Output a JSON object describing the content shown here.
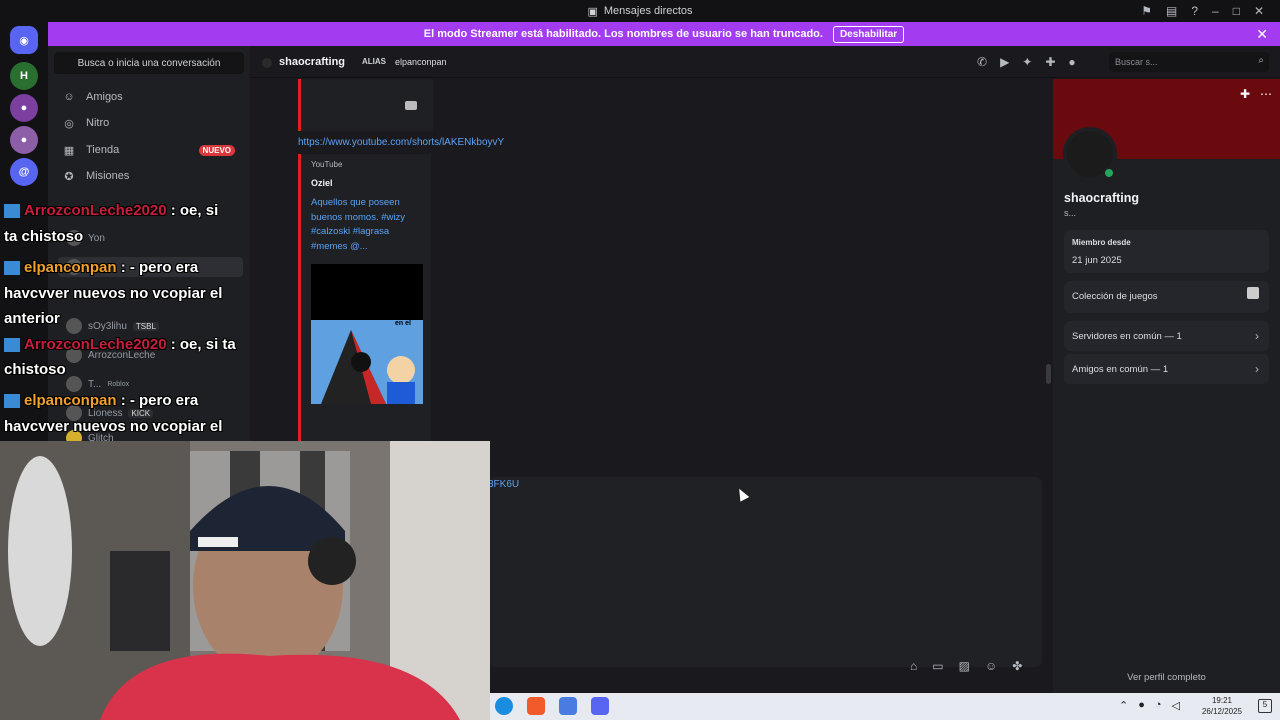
{
  "window": {
    "title": "Mensajes directos"
  },
  "banner": {
    "text": "El modo Streamer está habilitado. Los nombres de usuario se han truncado.",
    "button": "Deshabilitar"
  },
  "sidebar": {
    "search_placeholder": "Busca o inicia una conversación",
    "nav": [
      {
        "label": "Amigos",
        "icon": "friends-icon"
      },
      {
        "label": "Nitro",
        "icon": "nitro-icon"
      },
      {
        "label": "Tienda",
        "icon": "shop-icon",
        "badge": "NUEVO"
      },
      {
        "label": "Misiones",
        "icon": "quests-icon"
      }
    ],
    "dms": [
      {
        "name": "Yon"
      },
      {
        "name": "sOy3lihu",
        "tag": "TSBL"
      },
      {
        "name": "ArrozconLeche"
      },
      {
        "name": "T...",
        "sub": "Roblox"
      },
      {
        "name": "Lioness",
        "tag": "KICK"
      },
      {
        "name": "Glitch"
      }
    ]
  },
  "topbar": {
    "username": "shaocrafting",
    "alias_label": "ALIAS",
    "alias_value": "elpanconpan",
    "search_placeholder": "Buscar s..."
  },
  "chat": {
    "link1": "https://www.youtube.com/shorts/lAKENkboyvY",
    "embed": {
      "provider": "YouTube",
      "author": "Oziel",
      "description": "Aquellos que poseen buenos momos. #wizy #calzoski #lagrasa #memes @...",
      "thumb_text": "en el"
    },
    "link2": "3FK6U"
  },
  "profile": {
    "name": "shaocrafting",
    "sub": "s...",
    "member_since_label": "Miembro desde",
    "member_since": "21 jun 2025",
    "games": "Colección de juegos",
    "servers": "Servidores en común — 1",
    "friends": "Amigos en común — 1",
    "full_profile": "Ver perfil completo"
  },
  "overlay_chat": [
    {
      "nick": "ArrozconLeche2020",
      "color": "#c81e3c",
      "msg": ": oe, si",
      "cont": "ta chistoso"
    },
    {
      "nick": "elpanconpan",
      "color": "#f2a12a",
      "msg": ": - pero era",
      "cont": "havcvver nuevos no vcopiar el",
      "cont2": "anterior"
    },
    {
      "nick": "ArrozconLeche2020",
      "color": "#c81e3c",
      "msg": ": oe, si ta",
      "cont": "chistoso"
    },
    {
      "nick": "elpanconpan",
      "color": "#f2a12a",
      "msg": ": - pero era",
      "cont": "havcvver nuevos no vcopiar el"
    }
  ],
  "taskbar": {
    "time": "19:21",
    "date": "26/12/2025",
    "notifications": "5"
  }
}
